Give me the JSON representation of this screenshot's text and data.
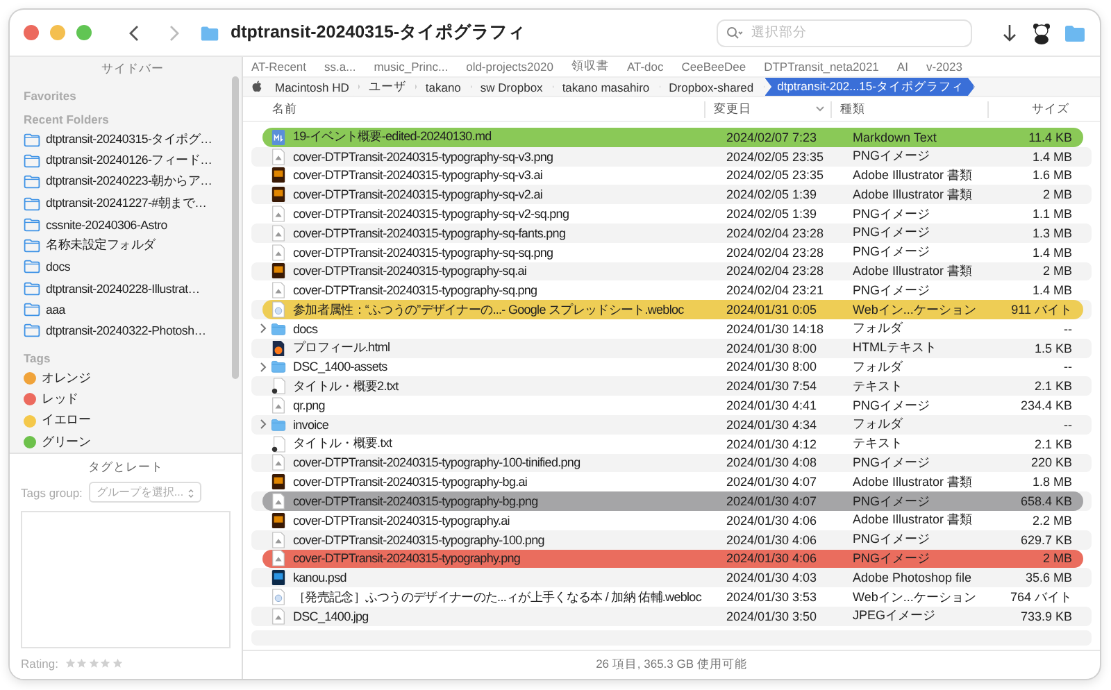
{
  "window": {
    "title": "dtptransit-20240315-タイポグラフィ"
  },
  "search": {
    "placeholder": "選択部分"
  },
  "sidebar": {
    "title": "サイドバー",
    "sections": [
      {
        "heading": "Favorites"
      },
      {
        "heading": "Recent Folders",
        "kind": "folders",
        "items": [
          {
            "label": "dtptransit-20240315-タイポグ…"
          },
          {
            "label": "dtptransit-20240126-フィード…"
          },
          {
            "label": "dtptransit-20240223-朝からア…"
          },
          {
            "label": "dtptransit-20241227-#朝まで…"
          },
          {
            "label": "cssnite-20240306-Astro"
          },
          {
            "label": "名称未設定フォルダ"
          },
          {
            "label": "docs"
          },
          {
            "label": "dtptransit-20240228-Illustrat…"
          },
          {
            "label": "aaa"
          },
          {
            "label": "dtptransit-20240322-Photosh…"
          }
        ]
      },
      {
        "heading": "Tags",
        "kind": "tags",
        "items": [
          {
            "label": "オレンジ",
            "color": "#f0a33a"
          },
          {
            "label": "レッド",
            "color": "#ec6a5e"
          },
          {
            "label": "イエロー",
            "color": "#f4c84a"
          },
          {
            "label": "グリーン",
            "color": "#6dc14b"
          }
        ]
      }
    ],
    "panel": {
      "title": "タグとレート",
      "group_label": "Tags group:",
      "group_placeholder": "グループを選択...",
      "rating_label": "Rating:",
      "stars": 0
    }
  },
  "favorites_bar": [
    "AT-Recent",
    "ss.a...",
    "music_Princ...",
    "old-projects2020",
    "領収書",
    "AT-doc",
    "CeeBeeDee",
    "DTPTransit_neta2021",
    "AI",
    "v-2023"
  ],
  "path_bar": [
    {
      "label": "Macintosh HD",
      "selected": false
    },
    {
      "label": "ユーザ",
      "selected": false
    },
    {
      "label": "takano",
      "selected": false
    },
    {
      "label": "sw Dropbox",
      "selected": false
    },
    {
      "label": "takano masahiro",
      "selected": false
    },
    {
      "label": "Dropbox-shared",
      "selected": false
    },
    {
      "label": "dtptransit-202...15-タイポグラフィ",
      "selected": true
    }
  ],
  "table": {
    "columns": [
      "名前",
      "変更日",
      "種類",
      "サイズ"
    ],
    "rows": [
      {
        "kind": "markdown",
        "name": "19-イベント概要-edited-20240130.md",
        "date": "2024/02/07 7:23",
        "file_type": "Markdown Text",
        "size": "11.4 KB",
        "color": "#8ac957"
      },
      {
        "kind": "image",
        "name": "cover-DTPTransit-20240315-typography-sq-v3.png",
        "date": "2024/02/05 23:35",
        "file_type": "PNGイメージ",
        "size": "1.4 MB"
      },
      {
        "kind": "illustrator",
        "name": "cover-DTPTransit-20240315-typography-sq-v3.ai",
        "date": "2024/02/05 23:35",
        "file_type": "Adobe Illustrator 書類",
        "size": "1.6 MB"
      },
      {
        "kind": "illustrator",
        "name": "cover-DTPTransit-20240315-typography-sq-v2.ai",
        "date": "2024/02/05 1:39",
        "file_type": "Adobe Illustrator 書類",
        "size": "2 MB"
      },
      {
        "kind": "image",
        "name": "cover-DTPTransit-20240315-typography-sq-v2-sq.png",
        "date": "2024/02/05 1:39",
        "file_type": "PNGイメージ",
        "size": "1.1 MB"
      },
      {
        "kind": "image",
        "name": "cover-DTPTransit-20240315-typography-sq-fants.png",
        "date": "2024/02/04 23:28",
        "file_type": "PNGイメージ",
        "size": "1.3 MB"
      },
      {
        "kind": "image",
        "name": "cover-DTPTransit-20240315-typography-sq-sq.png",
        "date": "2024/02/04 23:28",
        "file_type": "PNGイメージ",
        "size": "1.4 MB"
      },
      {
        "kind": "illustrator",
        "name": "cover-DTPTransit-20240315-typography-sq.ai",
        "date": "2024/02/04 23:28",
        "file_type": "Adobe Illustrator 書類",
        "size": "2 MB"
      },
      {
        "kind": "image",
        "name": "cover-DTPTransit-20240315-typography-sq.png",
        "date": "2024/02/04 23:21",
        "file_type": "PNGイメージ",
        "size": "1.4 MB"
      },
      {
        "kind": "weblink",
        "name": "参加者属性：“ふつうの”デザイナーの...- Google スプレッドシート.webloc",
        "date": "2024/01/31 0:05",
        "file_type": "Webイン...ケーション",
        "size": "911 バイト",
        "color": "#eecd55"
      },
      {
        "kind": "folder",
        "name": "docs",
        "date": "2024/01/30 14:18",
        "file_type": "フォルダ",
        "size": "--"
      },
      {
        "kind": "html",
        "name": "プロフィール.html",
        "date": "2024/01/30 8:00",
        "file_type": "HTMLテキスト",
        "size": "1.5 KB"
      },
      {
        "kind": "folder",
        "name": "DSC_1400-assets",
        "date": "2024/01/30 8:00",
        "file_type": "フォルダ",
        "size": "--"
      },
      {
        "kind": "text",
        "name": "タイトル・概要2.txt",
        "date": "2024/01/30 7:54",
        "file_type": "テキスト",
        "size": "2.1 KB"
      },
      {
        "kind": "image",
        "name": "qr.png",
        "date": "2024/01/30 4:41",
        "file_type": "PNGイメージ",
        "size": "234.4 KB"
      },
      {
        "kind": "folder",
        "name": "invoice",
        "date": "2024/01/30 4:34",
        "file_type": "フォルダ",
        "size": "--"
      },
      {
        "kind": "text",
        "name": "タイトル・概要.txt",
        "date": "2024/01/30 4:12",
        "file_type": "テキスト",
        "size": "2.1 KB"
      },
      {
        "kind": "image",
        "name": "cover-DTPTransit-20240315-typography-100-tinified.png",
        "date": "2024/01/30 4:08",
        "file_type": "PNGイメージ",
        "size": "220 KB"
      },
      {
        "kind": "illustrator",
        "name": "cover-DTPTransit-20240315-typography-bg.ai",
        "date": "2024/01/30 4:07",
        "file_type": "Adobe Illustrator 書類",
        "size": "1.8 MB"
      },
      {
        "kind": "image",
        "name": "cover-DTPTransit-20240315-typography-bg.png",
        "date": "2024/01/30 4:07",
        "file_type": "PNGイメージ",
        "size": "658.4 KB",
        "color": "#a5a5a7"
      },
      {
        "kind": "illustrator",
        "name": "cover-DTPTransit-20240315-typography.ai",
        "date": "2024/01/30 4:06",
        "file_type": "Adobe Illustrator 書類",
        "size": "2.2 MB"
      },
      {
        "kind": "image",
        "name": "cover-DTPTransit-20240315-typography-100.png",
        "date": "2024/01/30 4:06",
        "file_type": "PNGイメージ",
        "size": "629.7 KB"
      },
      {
        "kind": "image",
        "name": "cover-DTPTransit-20240315-typography.png",
        "date": "2024/01/30 4:06",
        "file_type": "PNGイメージ",
        "size": "2 MB",
        "color": "#ea6d5e"
      },
      {
        "kind": "photoshop",
        "name": "kanou.psd",
        "date": "2024/01/30 4:03",
        "file_type": "Adobe Photoshop file",
        "size": "35.6 MB"
      },
      {
        "kind": "weblink",
        "name": "［発売記念］ふつうのデザイナーのた...ィが上手くなる本 / 加納 佑輔.webloc",
        "date": "2024/01/30 3:53",
        "file_type": "Webイン...ケーション",
        "size": "764 バイト"
      },
      {
        "kind": "image",
        "name": "DSC_1400.jpg",
        "date": "2024/01/30 3:50",
        "file_type": "JPEGイメージ",
        "size": "733.9 KB"
      }
    ]
  },
  "status_bar": "26 項目, 365.3 GB 使用可能"
}
